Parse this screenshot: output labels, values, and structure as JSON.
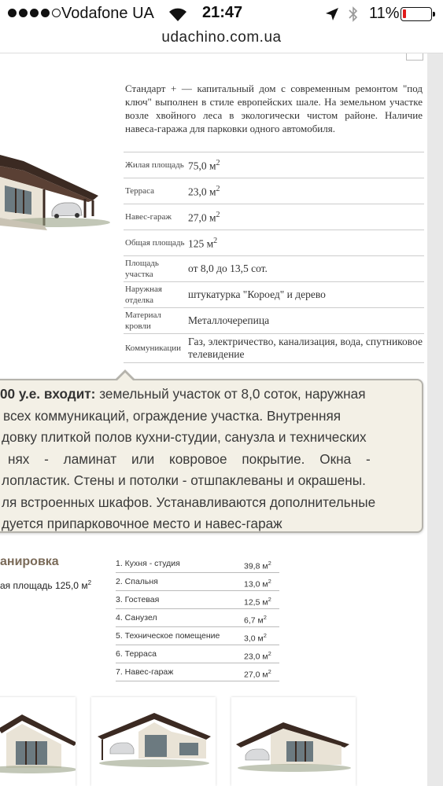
{
  "status_bar": {
    "carrier": "Vodafone UA",
    "time": "21:47",
    "battery_percent": "11%",
    "battery_level": 0.11,
    "signal_bars": 4
  },
  "url_bar": {
    "url": "udachino.com.ua"
  },
  "description": "Стандарт + — капитальный дом с современным ремонтом \"под ключ\" выполнен в стиле европейских шале. На земельном участке возле хвойного леса в экологически чистом районе. Наличие навеса-гаража для парковки одного автомобиля.",
  "specs": [
    {
      "label": "Жилая площадь",
      "value": "75,0 м",
      "sup": "2"
    },
    {
      "label": "Терраса",
      "value": "23,0 м",
      "sup": "2"
    },
    {
      "label": "Навес-гараж",
      "value": "27,0 м",
      "sup": "2"
    },
    {
      "label": "Общая площадь",
      "value": "125 м",
      "sup": "2"
    },
    {
      "label": "Площадь участка",
      "value": "от 8,0 до 13,5 сот.",
      "sup": ""
    },
    {
      "label": "Наружная отделка",
      "value": "штукатурка \"Короед\" и дерево",
      "sup": ""
    },
    {
      "label": "Материал кровли",
      "value": "Металлочерепица",
      "sup": ""
    },
    {
      "label": "Коммуникации",
      "value": "Газ, электричество, канализация, вода, спутниковое телевидение",
      "sup": ""
    }
  ],
  "callout": {
    "lead": "00 у.е. входит:",
    "line1_rest": "земельный участок от 8,0 соток, наружная",
    "line2": "всех коммуникаций, ограждение участка. Внутренняя",
    "line3": "довку плиткой полов кухни-студии, санузла и технических",
    "line4": "нях - ламинат или ковровое покрытие. Окна -",
    "line5": "лопластик. Стены и потолки - отшпаклеваны и окрашены.",
    "line6": "ля встроенных шкафов. Устанавливаются дополнительные",
    "line7": "дуется припарковочное место и навес-гараж"
  },
  "plan": {
    "title": "анировка",
    "total_area": "ая площадь 125,0 м",
    "total_area_sup": "2",
    "rooms": [
      {
        "name": "1. Кухня - студия",
        "value": "39,8 м",
        "sup": "2"
      },
      {
        "name": "2. Спальня",
        "value": "13,0 м",
        "sup": "2"
      },
      {
        "name": "3. Гостевая",
        "value": "12,5 м",
        "sup": "2"
      },
      {
        "name": "4. Санузел",
        "value": "6,7 м",
        "sup": "2"
      },
      {
        "name": "5. Техническое помещение",
        "value": "3,0 м",
        "sup": "2"
      },
      {
        "name": "6. Терраса",
        "value": "23,0 м",
        "sup": "2"
      },
      {
        "name": "7. Навес-гараж",
        "value": "27,0 м",
        "sup": "2"
      }
    ]
  },
  "colors": {
    "callout_bg": "#f3f0e6",
    "callout_border": "#b5b3ac",
    "plan_title": "#7a6a58",
    "battery_low": "#e01b1b"
  }
}
